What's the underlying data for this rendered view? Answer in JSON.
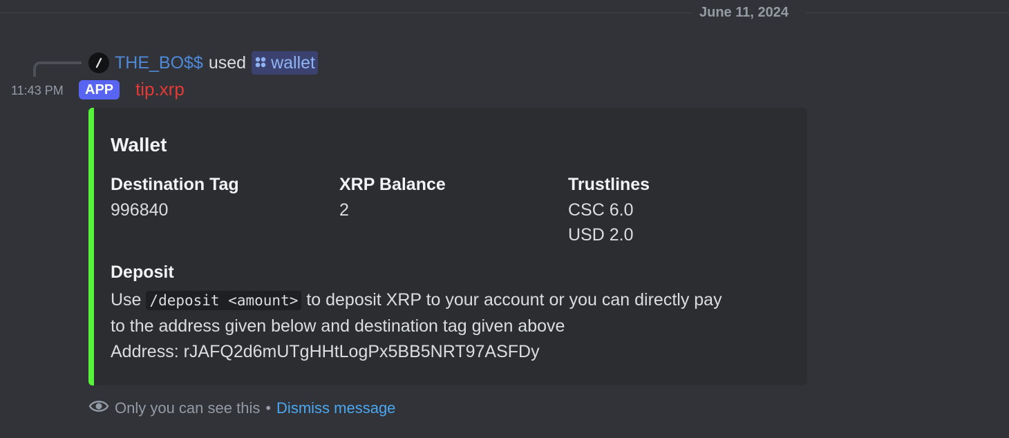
{
  "divider": {
    "date": "June 11, 2024"
  },
  "reply": {
    "icon": "slash-command-icon",
    "user": "THE_BO$$",
    "used_text": "used",
    "command_icon": "app-grid-icon",
    "command": "wallet"
  },
  "message": {
    "timestamp": "11:43 PM",
    "badge": "APP",
    "author": "tip.xrp"
  },
  "embed": {
    "accent_color": "#57f23a",
    "title": "Wallet",
    "fields": [
      {
        "name": "Destination Tag",
        "value": "996840"
      },
      {
        "name": "XRP Balance",
        "value": "2"
      },
      {
        "name": "Trustlines",
        "value": "CSC 6.0\nUSD 2.0"
      }
    ],
    "deposit": {
      "name": "Deposit",
      "text_prefix": "Use",
      "code": "/deposit <amount>",
      "text_line1_rest": "to deposit XRP to your account or you can directly pay",
      "text_line2": "to the address given below and destination tag given above",
      "address": "Address: rJAFQ2d6mUTgHHtLogPx5BB5NRT97ASFDy"
    }
  },
  "footer": {
    "icon": "eye-icon",
    "notice": "Only you can see this",
    "separator": "•",
    "dismiss": "Dismiss message"
  }
}
